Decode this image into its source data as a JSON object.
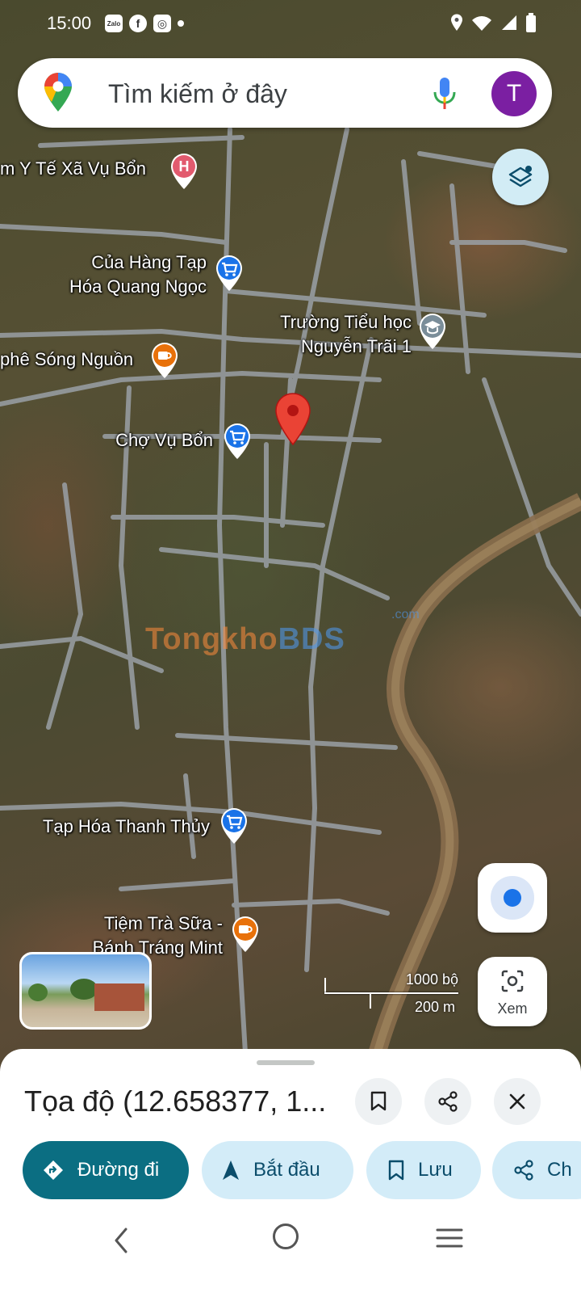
{
  "status_bar": {
    "time": "15:00",
    "app_badges": [
      "Zalo",
      "f",
      "◎"
    ]
  },
  "search": {
    "placeholder": "Tìm kiếm ở đây",
    "avatar_letter": "T"
  },
  "map": {
    "pois": [
      {
        "id": "health",
        "name": "m Y Tế Xã Vụ Bổn",
        "icon": "hospital-icon",
        "color": "#d93025"
      },
      {
        "id": "store1_line1",
        "name": "Của Hàng Tạp",
        "icon": "shopping-cart-icon",
        "color": "#1a73e8"
      },
      {
        "id": "store1_line2",
        "name": "Hóa Quang Ngọc"
      },
      {
        "id": "school_line1",
        "name": "Trường Tiểu học",
        "icon": "school-icon",
        "color": "#607d8b"
      },
      {
        "id": "school_line2",
        "name": "Nguyễn Trãi 1"
      },
      {
        "id": "cafe",
        "name": "phê Sóng Nguồn",
        "icon": "coffee-icon",
        "color": "#e8710a"
      },
      {
        "id": "market",
        "name": "Chợ Vụ Bổn",
        "icon": "shopping-cart-icon",
        "color": "#1a73e8"
      },
      {
        "id": "store2",
        "name": "Tạp Hóa Thanh Thủy",
        "icon": "shopping-cart-icon",
        "color": "#1a73e8"
      },
      {
        "id": "tea_line1",
        "name": "Tiệm Trà Sữa -",
        "icon": "coffee-icon",
        "color": "#e8710a"
      },
      {
        "id": "tea_line2",
        "name": "Bánh Tráng Mint"
      }
    ],
    "watermark": {
      "part1": "Tongkho",
      "part2": "BDS",
      "suffix": ".com"
    },
    "scale": {
      "feet": "1000 bộ",
      "meters": "200 m"
    },
    "xem_label": "Xem",
    "pin_color": "#ea4335"
  },
  "sheet": {
    "title": "Tọa độ (12.658377, 1..."
  },
  "actions": {
    "directions": "Đường đi",
    "start": "Bắt đầu",
    "save": "Lưu",
    "share": "Ch"
  }
}
